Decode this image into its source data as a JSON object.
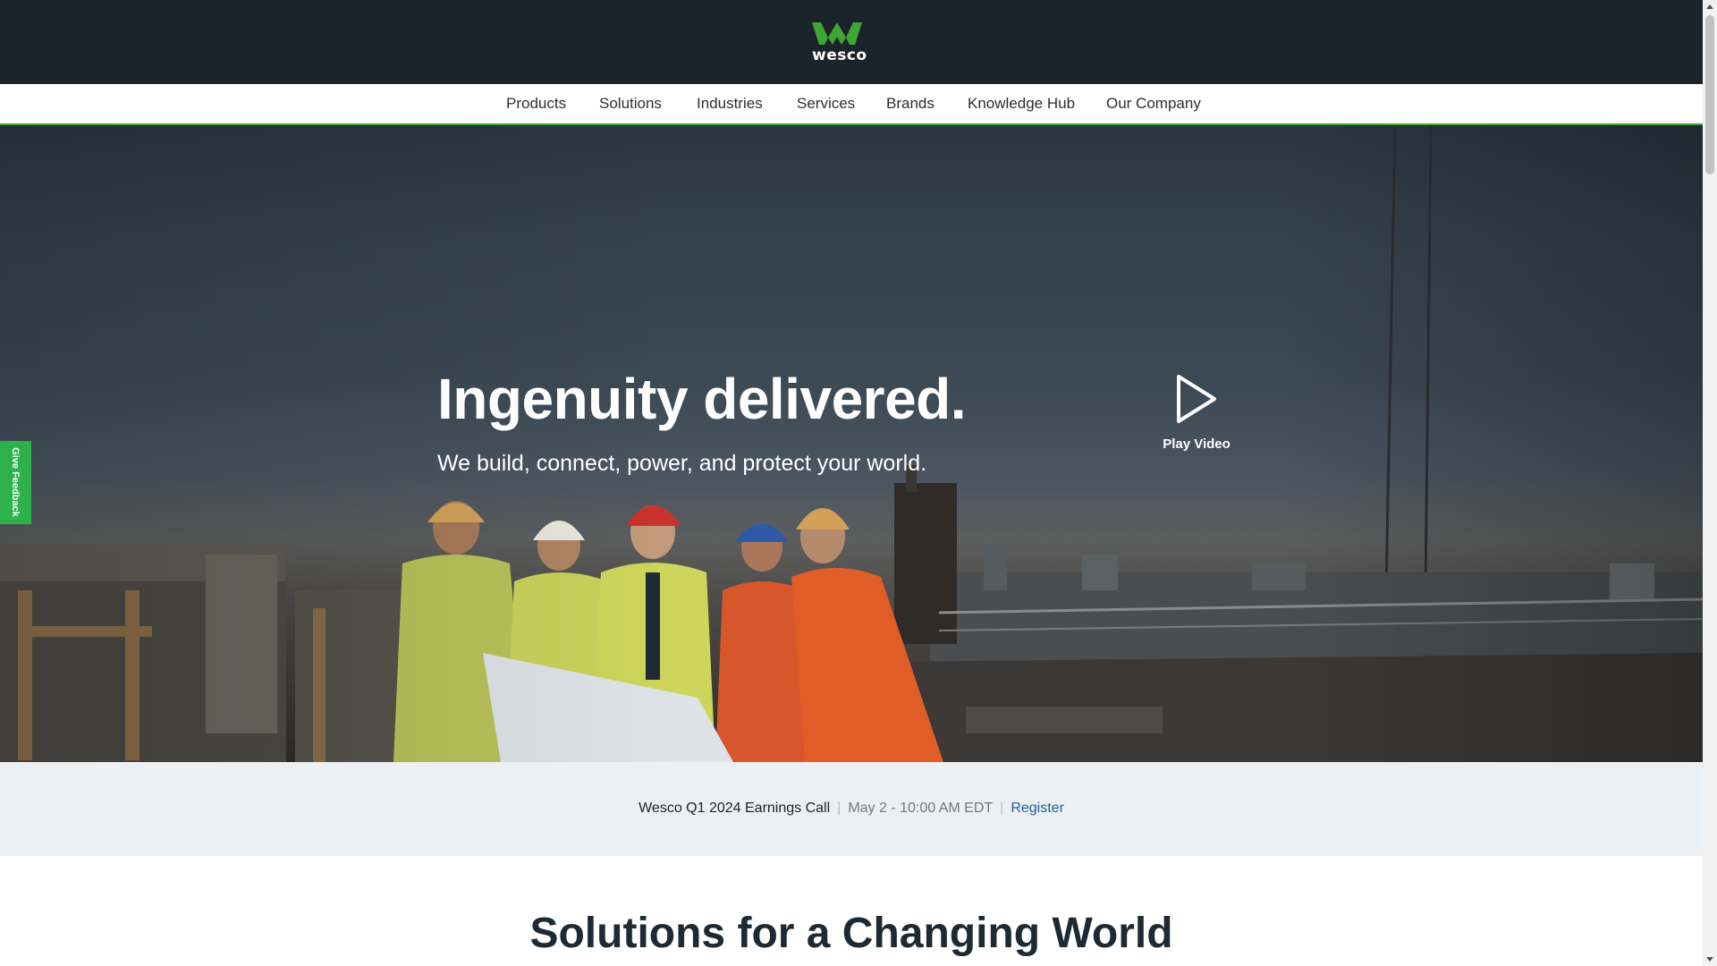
{
  "header": {
    "logo_text": "wesco",
    "brand_green": "#3fa535",
    "background": "#1c242b"
  },
  "nav": {
    "items": [
      "Products",
      "Solutions",
      "Industries",
      "Services",
      "Brands",
      "Knowledge Hub",
      "Our Company"
    ]
  },
  "hero": {
    "title": "Ingenuity delivered.",
    "subtitle": "We build, connect, power, and protect your world.",
    "play_label": "Play Video",
    "play_icon": "play-icon"
  },
  "feedback": {
    "label": "Give Feedback",
    "color": "#2db24a"
  },
  "announcement": {
    "event": "Wesco Q1 2024 Earnings Call",
    "separator": "|",
    "date": "May 2 - 10:00 AM EDT",
    "link": "Register",
    "link_color": "#1d5e9c"
  },
  "section": {
    "title": "Solutions for a Changing World"
  }
}
